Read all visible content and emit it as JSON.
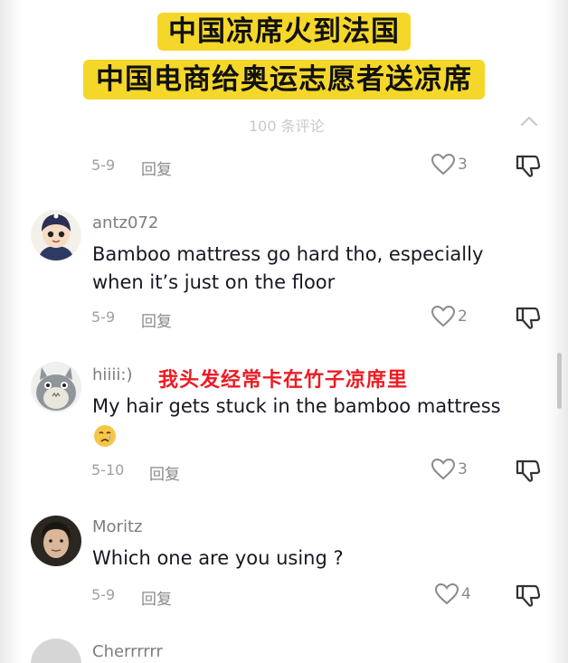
{
  "overlay": {
    "headline_1": "中国凉席火到法国",
    "headline_2": "中国电商给奥运志愿者送凉席"
  },
  "panel": {
    "comment_count": "100 条评论"
  },
  "ui": {
    "reply_label": "回复",
    "collapse_icon": "chevron-up-icon",
    "like_icon": "heart-outline-icon",
    "dislike_icon": "thumbs-down-icon",
    "annotation_color": "#ee1b24",
    "headline_bg": "#f5d72a"
  },
  "top_row": {
    "date": "5-9",
    "likes": "3"
  },
  "comments": [
    {
      "username": "antz072",
      "text": "Bamboo mattress go hard tho, especially when it’s just on the floor",
      "date": "5-9",
      "likes": "2"
    },
    {
      "username": "hiiii:)",
      "annotation": "我头发经常卡在竹子凉席里",
      "text": "My hair gets stuck in the bamboo mattress",
      "emoji": "crying-face",
      "date": "5-10",
      "likes": "3"
    },
    {
      "username": "Moritz",
      "text": "Which one are you using ?",
      "date": "5-9",
      "likes": "4"
    },
    {
      "username": "Cherrrrrr"
    }
  ]
}
